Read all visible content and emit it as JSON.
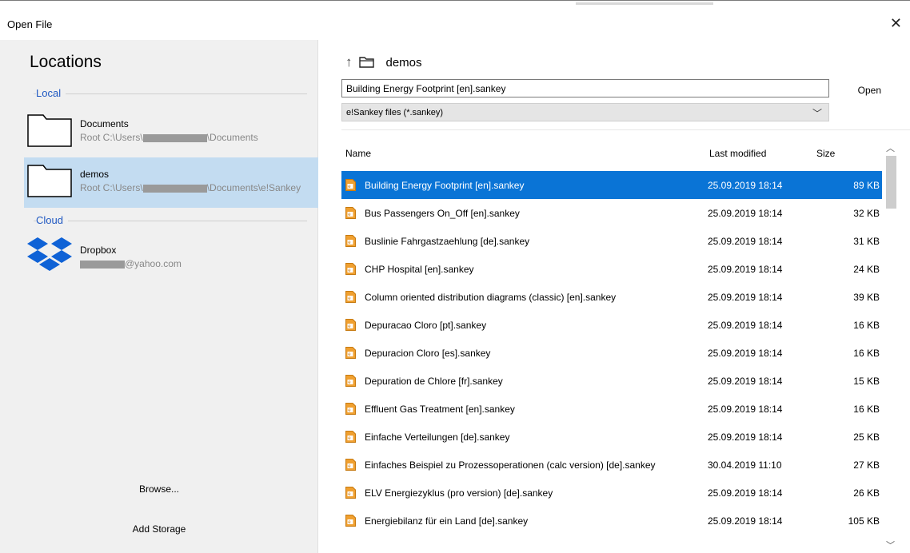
{
  "window": {
    "title": "Open File",
    "close_label": "✕"
  },
  "locations": {
    "heading": "Locations",
    "local_label": "Local",
    "cloud_label": "Cloud",
    "items": [
      {
        "name": "Documents",
        "path_prefix": "Root C:\\Users\\",
        "path_suffix": "\\Documents"
      },
      {
        "name": "demos",
        "path_prefix": "Root C:\\Users\\",
        "path_suffix": "\\Documents\\e!Sankey"
      }
    ],
    "cloud_items": [
      {
        "name": "Dropbox",
        "account_suffix": "@yahoo.com"
      }
    ],
    "browse_label": "Browse...",
    "add_storage_label": "Add Storage"
  },
  "nav": {
    "up_icon": "↑",
    "current_folder": "demos"
  },
  "filename": {
    "value": "Building Energy Footprint [en].sankey"
  },
  "open_label": "Open",
  "filter": {
    "selected": "e!Sankey files (*.sankey)",
    "chevron": "﹀"
  },
  "table": {
    "columns": {
      "name": "Name",
      "modified": "Last modified",
      "size": "Size"
    },
    "rows": [
      {
        "name": "Building Energy Footprint [en].sankey",
        "modified": "25.09.2019 18:14",
        "size": "89 KB",
        "selected": true
      },
      {
        "name": "Bus Passengers On_Off [en].sankey",
        "modified": "25.09.2019 18:14",
        "size": "32 KB"
      },
      {
        "name": "Buslinie Fahrgastzaehlung [de].sankey",
        "modified": "25.09.2019 18:14",
        "size": "31 KB"
      },
      {
        "name": "CHP Hospital [en].sankey",
        "modified": "25.09.2019 18:14",
        "size": "24 KB"
      },
      {
        "name": "Column oriented distribution diagrams (classic) [en].sankey",
        "modified": "25.09.2019 18:14",
        "size": "39 KB"
      },
      {
        "name": "Depuracao Cloro [pt].sankey",
        "modified": "25.09.2019 18:14",
        "size": "16 KB"
      },
      {
        "name": "Depuracion Cloro [es].sankey",
        "modified": "25.09.2019 18:14",
        "size": "16 KB"
      },
      {
        "name": "Depuration de Chlore [fr].sankey",
        "modified": "25.09.2019 18:14",
        "size": "15 KB"
      },
      {
        "name": "Effluent Gas Treatment [en].sankey",
        "modified": "25.09.2019 18:14",
        "size": "16 KB"
      },
      {
        "name": "Einfache Verteilungen [de].sankey",
        "modified": "25.09.2019 18:14",
        "size": "25 KB"
      },
      {
        "name": "Einfaches Beispiel zu Prozessoperationen (calc version) [de].sankey",
        "modified": "30.04.2019 11:10",
        "size": "27 KB"
      },
      {
        "name": "ELV Energiezyklus (pro version) [de].sankey",
        "modified": "25.09.2019 18:14",
        "size": "26 KB"
      },
      {
        "name": "Energiebilanz für ein Land [de].sankey",
        "modified": "25.09.2019 18:14",
        "size": "105 KB"
      }
    ]
  },
  "colors": {
    "accent": "#0a74d6",
    "selected_location": "#c3dcf1",
    "section_label": "#1f58c2",
    "file_icon": "#f0a030"
  }
}
